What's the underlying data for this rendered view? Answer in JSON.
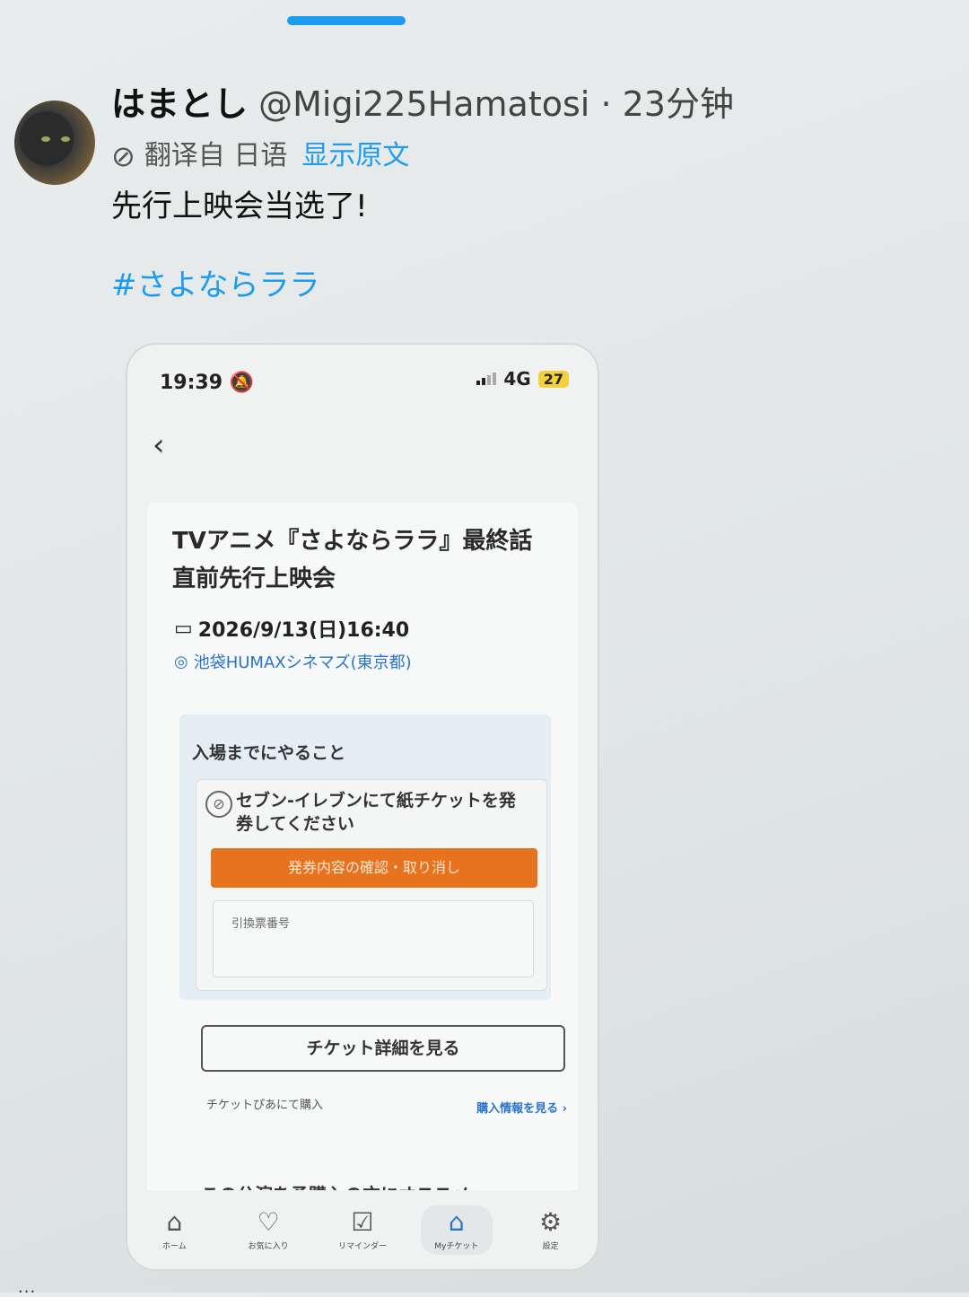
{
  "tweet": {
    "display_name": "はまとし",
    "handle": "@Migi225Hamatosi",
    "separator": "·",
    "time": "23分钟",
    "translated_from": "翻译自 日语",
    "show_original": "显示原文",
    "text": "先行上映会当选了!",
    "hashtag": "#さよならララ"
  },
  "phone_screenshot": {
    "status_time": "19:39",
    "network": "4G",
    "battery": "27",
    "event_title_line1": "TVアニメ『さよならララ』最終話",
    "event_title_line2": "直前先行上映会",
    "date": "2026/9/13(日)16:40",
    "venue": "池袋HUMAXシネマズ(東京都)",
    "todo_title": "入場までにやること",
    "todo_message": "セブン-イレブンにて紙チケットを発券してください",
    "orange_button": "発券内容の確認・取り消し",
    "exchange_label": "引換票番号",
    "ticket_detail_button": "チケット詳細を見る",
    "purchased_via": "チケットぴあにて購入",
    "purchase_info_link": "購入情報を見る",
    "cut_off_text": "この公演を予購入の方にオススメ",
    "tabs": [
      {
        "label": "ホーム",
        "icon": "home-icon"
      },
      {
        "label": "お気に入り",
        "icon": "heart-icon"
      },
      {
        "label": "リマインダー",
        "icon": "checkbox-icon"
      },
      {
        "label": "Myチケット",
        "icon": "ticket-icon"
      },
      {
        "label": "設定",
        "icon": "gear-icon"
      }
    ]
  },
  "colors": {
    "link": "#1d9bf0",
    "orange": "#e8731f",
    "app_blue": "#2b74c9"
  }
}
